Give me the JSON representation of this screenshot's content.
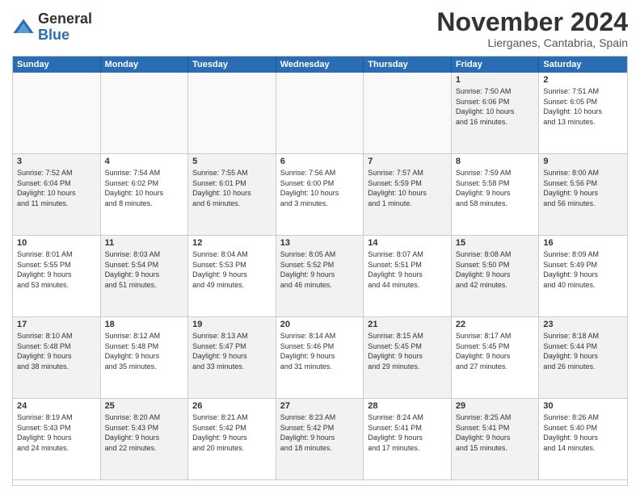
{
  "logo": {
    "general": "General",
    "blue": "Blue"
  },
  "title": "November 2024",
  "location": "Lierganes, Cantabria, Spain",
  "days_of_week": [
    "Sunday",
    "Monday",
    "Tuesday",
    "Wednesday",
    "Thursday",
    "Friday",
    "Saturday"
  ],
  "weeks": [
    [
      {
        "day": "",
        "text": "",
        "empty": true
      },
      {
        "day": "",
        "text": "",
        "empty": true
      },
      {
        "day": "",
        "text": "",
        "empty": true
      },
      {
        "day": "",
        "text": "",
        "empty": true
      },
      {
        "day": "",
        "text": "",
        "empty": true
      },
      {
        "day": "1",
        "text": "Sunrise: 7:50 AM\nSunset: 6:06 PM\nDaylight: 10 hours\nand 16 minutes.",
        "shaded": true
      },
      {
        "day": "2",
        "text": "Sunrise: 7:51 AM\nSunset: 6:05 PM\nDaylight: 10 hours\nand 13 minutes.",
        "shaded": false
      }
    ],
    [
      {
        "day": "3",
        "text": "Sunrise: 7:52 AM\nSunset: 6:04 PM\nDaylight: 10 hours\nand 11 minutes.",
        "shaded": true
      },
      {
        "day": "4",
        "text": "Sunrise: 7:54 AM\nSunset: 6:02 PM\nDaylight: 10 hours\nand 8 minutes.",
        "shaded": false
      },
      {
        "day": "5",
        "text": "Sunrise: 7:55 AM\nSunset: 6:01 PM\nDaylight: 10 hours\nand 6 minutes.",
        "shaded": true
      },
      {
        "day": "6",
        "text": "Sunrise: 7:56 AM\nSunset: 6:00 PM\nDaylight: 10 hours\nand 3 minutes.",
        "shaded": false
      },
      {
        "day": "7",
        "text": "Sunrise: 7:57 AM\nSunset: 5:59 PM\nDaylight: 10 hours\nand 1 minute.",
        "shaded": true
      },
      {
        "day": "8",
        "text": "Sunrise: 7:59 AM\nSunset: 5:58 PM\nDaylight: 9 hours\nand 58 minutes.",
        "shaded": false
      },
      {
        "day": "9",
        "text": "Sunrise: 8:00 AM\nSunset: 5:56 PM\nDaylight: 9 hours\nand 56 minutes.",
        "shaded": true
      }
    ],
    [
      {
        "day": "10",
        "text": "Sunrise: 8:01 AM\nSunset: 5:55 PM\nDaylight: 9 hours\nand 53 minutes.",
        "shaded": false
      },
      {
        "day": "11",
        "text": "Sunrise: 8:03 AM\nSunset: 5:54 PM\nDaylight: 9 hours\nand 51 minutes.",
        "shaded": true
      },
      {
        "day": "12",
        "text": "Sunrise: 8:04 AM\nSunset: 5:53 PM\nDaylight: 9 hours\nand 49 minutes.",
        "shaded": false
      },
      {
        "day": "13",
        "text": "Sunrise: 8:05 AM\nSunset: 5:52 PM\nDaylight: 9 hours\nand 46 minutes.",
        "shaded": true
      },
      {
        "day": "14",
        "text": "Sunrise: 8:07 AM\nSunset: 5:51 PM\nDaylight: 9 hours\nand 44 minutes.",
        "shaded": false
      },
      {
        "day": "15",
        "text": "Sunrise: 8:08 AM\nSunset: 5:50 PM\nDaylight: 9 hours\nand 42 minutes.",
        "shaded": true
      },
      {
        "day": "16",
        "text": "Sunrise: 8:09 AM\nSunset: 5:49 PM\nDaylight: 9 hours\nand 40 minutes.",
        "shaded": false
      }
    ],
    [
      {
        "day": "17",
        "text": "Sunrise: 8:10 AM\nSunset: 5:48 PM\nDaylight: 9 hours\nand 38 minutes.",
        "shaded": true
      },
      {
        "day": "18",
        "text": "Sunrise: 8:12 AM\nSunset: 5:48 PM\nDaylight: 9 hours\nand 35 minutes.",
        "shaded": false
      },
      {
        "day": "19",
        "text": "Sunrise: 8:13 AM\nSunset: 5:47 PM\nDaylight: 9 hours\nand 33 minutes.",
        "shaded": true
      },
      {
        "day": "20",
        "text": "Sunrise: 8:14 AM\nSunset: 5:46 PM\nDaylight: 9 hours\nand 31 minutes.",
        "shaded": false
      },
      {
        "day": "21",
        "text": "Sunrise: 8:15 AM\nSunset: 5:45 PM\nDaylight: 9 hours\nand 29 minutes.",
        "shaded": true
      },
      {
        "day": "22",
        "text": "Sunrise: 8:17 AM\nSunset: 5:45 PM\nDaylight: 9 hours\nand 27 minutes.",
        "shaded": false
      },
      {
        "day": "23",
        "text": "Sunrise: 8:18 AM\nSunset: 5:44 PM\nDaylight: 9 hours\nand 26 minutes.",
        "shaded": true
      }
    ],
    [
      {
        "day": "24",
        "text": "Sunrise: 8:19 AM\nSunset: 5:43 PM\nDaylight: 9 hours\nand 24 minutes.",
        "shaded": false
      },
      {
        "day": "25",
        "text": "Sunrise: 8:20 AM\nSunset: 5:43 PM\nDaylight: 9 hours\nand 22 minutes.",
        "shaded": true
      },
      {
        "day": "26",
        "text": "Sunrise: 8:21 AM\nSunset: 5:42 PM\nDaylight: 9 hours\nand 20 minutes.",
        "shaded": false
      },
      {
        "day": "27",
        "text": "Sunrise: 8:23 AM\nSunset: 5:42 PM\nDaylight: 9 hours\nand 18 minutes.",
        "shaded": true
      },
      {
        "day": "28",
        "text": "Sunrise: 8:24 AM\nSunset: 5:41 PM\nDaylight: 9 hours\nand 17 minutes.",
        "shaded": false
      },
      {
        "day": "29",
        "text": "Sunrise: 8:25 AM\nSunset: 5:41 PM\nDaylight: 9 hours\nand 15 minutes.",
        "shaded": true
      },
      {
        "day": "30",
        "text": "Sunrise: 8:26 AM\nSunset: 5:40 PM\nDaylight: 9 hours\nand 14 minutes.",
        "shaded": false
      }
    ]
  ]
}
